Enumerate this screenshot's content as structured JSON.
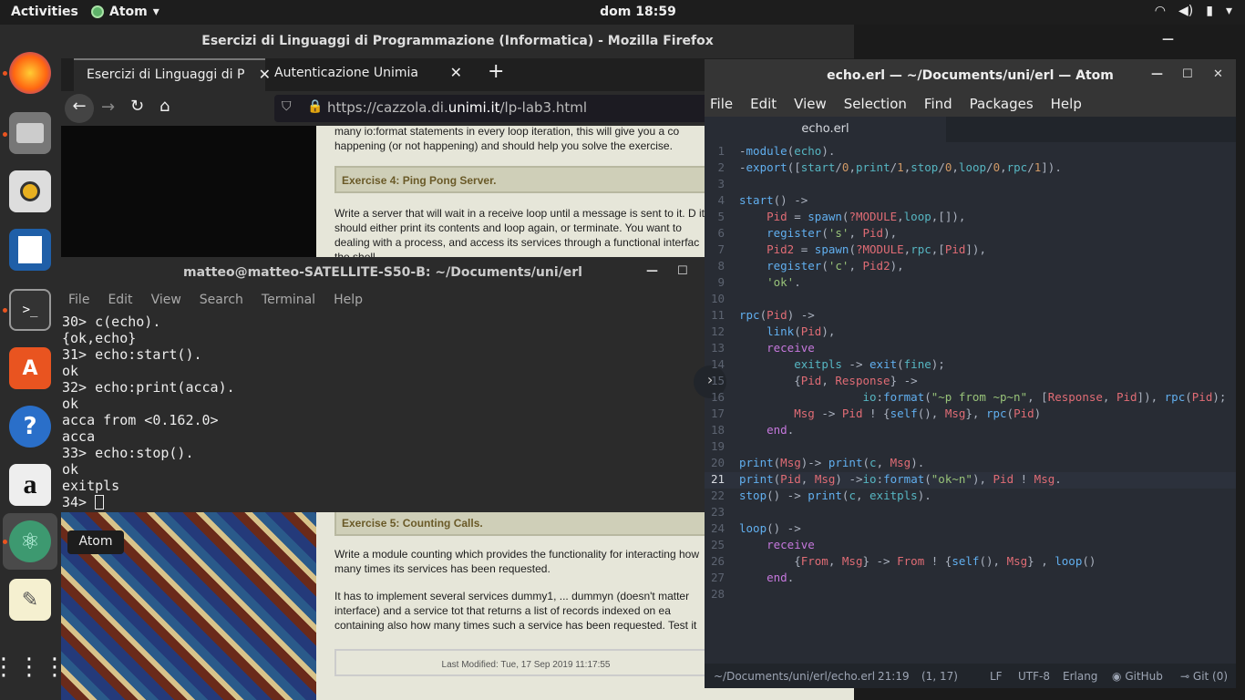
{
  "topbar": {
    "activities": "Activities",
    "app_name": "Atom",
    "clock": "dom 18:59"
  },
  "firefox": {
    "title": "Esercizi di Linguaggi di Programmazione (Informatica) - Mozilla Firefox",
    "tabs": [
      {
        "label": "Esercizi di Linguaggi di P"
      },
      {
        "label": "Autenticazione Unimia"
      }
    ],
    "url": {
      "prefix": "https://cazzola.di.",
      "domain": "unimi.it",
      "path": "/lp-lab3.html"
    },
    "page": {
      "top_text": "many io:format statements in every loop iteration, this will give you a co happening (or not happening) and should help you solve the exercise.",
      "ex4_title": "Exercise 4: Ping Pong Server.",
      "ex4_text": "Write a server that will wait in a receive loop until a message is sent to it. D it should either print its contents and loop again, or terminate. You want to dealing with a process, and access its services through a functional interfac the shell.",
      "ex5_title": "Exercise 5: Counting Calls.",
      "ex5_text1": "Write a module counting which provides the functionality for interacting how many times its services has been requested.",
      "ex5_text2": "It has to implement several services dummy1, ... dummyn (doesn't matter interface) and a service tot that returns a list of records indexed on ea containing also how many times such a service has been requested. Test it",
      "last_modified": "Last Modified: Tue, 17 Sep 2019 11:17:55"
    }
  },
  "terminal": {
    "title": "matteo@matteo-SATELLITE-S50-B: ~/Documents/uni/erl",
    "menu": [
      "File",
      "Edit",
      "View",
      "Search",
      "Terminal",
      "Help"
    ],
    "lines": [
      "30> c(echo).",
      "{ok,echo}",
      "31> echo:start().",
      "ok",
      "32> echo:print(acca).",
      "ok",
      "acca from <0.162.0>",
      "acca",
      "33> echo:stop().",
      "ok",
      "exitpls",
      "34> "
    ]
  },
  "dock": {
    "tooltip": "Atom"
  },
  "atom": {
    "title": "echo.erl — ~/Documents/uni/erl — Atom",
    "menu": [
      "File",
      "Edit",
      "View",
      "Selection",
      "Find",
      "Packages",
      "Help"
    ],
    "tab": "echo.erl",
    "code": [
      "-module(echo).",
      "-export([start/0,print/1,stop/0,loop/0,rpc/1]).",
      "",
      "start() ->",
      "    Pid = spawn(?MODULE,loop,[]),",
      "    register('s', Pid),",
      "    Pid2 = spawn(?MODULE,rpc,[Pid]),",
      "    register('c', Pid2),",
      "    'ok'.",
      "",
      "rpc(Pid) ->",
      "    link(Pid),",
      "    receive",
      "        exitpls -> exit(fine);",
      "        {Pid, Response} ->",
      "                  io:format(\"~p from ~p~n\", [Response, Pid]), rpc(Pid);",
      "        Msg -> Pid ! {self(), Msg}, rpc(Pid)",
      "    end.",
      "",
      "print(Msg)-> print(c, Msg).",
      "print(Pid, Msg) ->io:format(\"ok~n\"), Pid ! Msg.",
      "stop() -> print(c, exitpls).",
      "",
      "loop() ->",
      "    receive",
      "        {From, Msg} -> From ! {self(), Msg} , loop()",
      "    end.",
      ""
    ],
    "current_line": 21,
    "status": {
      "path": "~/Documents/uni/erl/echo.erl",
      "cursor": "21:19",
      "selection": "(1, 17)",
      "line_ending": "LF",
      "encoding": "UTF-8",
      "grammar": "Erlang",
      "github": "GitHub",
      "git": "Git (0)"
    }
  }
}
